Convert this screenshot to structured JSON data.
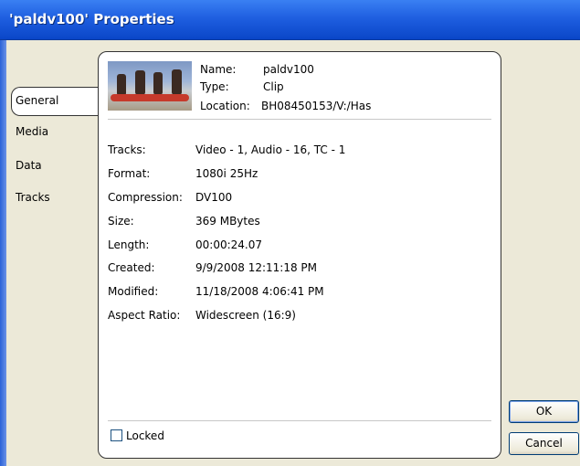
{
  "window": {
    "title": "'paldv100' Properties"
  },
  "tabs": [
    {
      "label": "General",
      "active": true
    },
    {
      "label": "Media",
      "active": false
    },
    {
      "label": "Data",
      "active": false
    },
    {
      "label": "Tracks",
      "active": false
    }
  ],
  "header": {
    "name_label": "Name:",
    "name_value": "paldv100",
    "type_label": "Type:",
    "type_value": "Clip",
    "location_label": "Location:",
    "location_value": "BH08450153/V:/Has"
  },
  "properties": [
    {
      "label": "Tracks:",
      "value": "Video - 1, Audio - 16, TC - 1"
    },
    {
      "label": "Format:",
      "value": "1080i 25Hz"
    },
    {
      "label": "Compression:",
      "value": "DV100"
    },
    {
      "label": "Size:",
      "value": "369 MBytes"
    },
    {
      "label": "Length:",
      "value": "00:00:24.07"
    },
    {
      "label": "Created:",
      "value": "9/9/2008 12:11:18 PM"
    },
    {
      "label": "Modified:",
      "value": "11/18/2008 4:06:41 PM"
    },
    {
      "label": "Aspect Ratio:",
      "value": "Widescreen (16:9)"
    }
  ],
  "locked": {
    "label": "Locked",
    "checked": false
  },
  "buttons": {
    "ok": "OK",
    "cancel": "Cancel"
  },
  "colors": {
    "titlebar": "#1f5fe0",
    "dialog_bg": "#ece9d8",
    "panel_bg": "#ffffff"
  }
}
